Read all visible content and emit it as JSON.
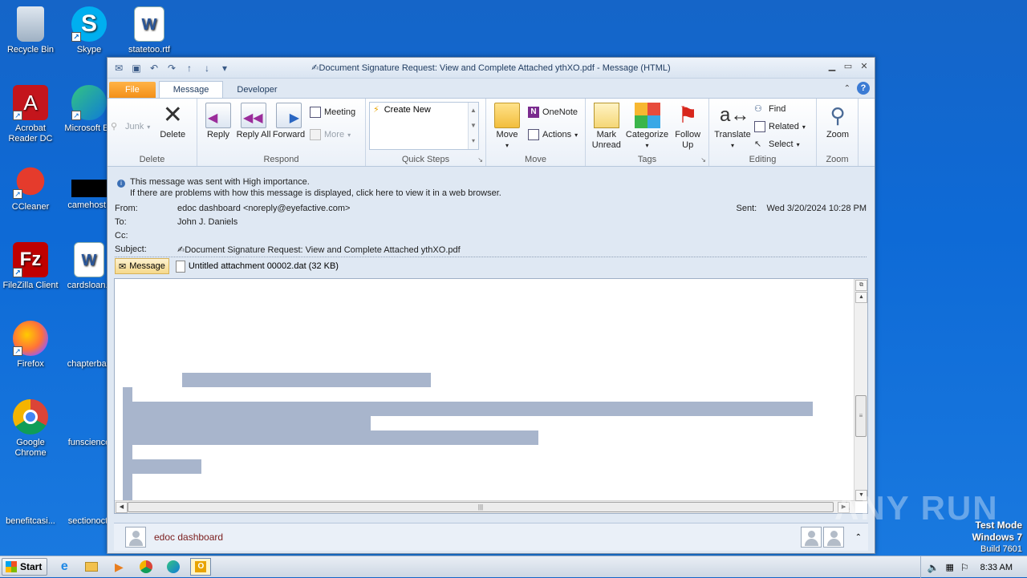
{
  "desktop": {
    "icons": [
      {
        "label": "Recycle Bin"
      },
      {
        "label": "Skype"
      },
      {
        "label": "statetoo.rtf"
      },
      {
        "label": "Acrobat Reader DC"
      },
      {
        "label": "Microsoft Ed"
      },
      {
        "label": "CCleaner"
      },
      {
        "label": "camehost.j"
      },
      {
        "label": "FileZilla Client"
      },
      {
        "label": "cardsloan.r"
      },
      {
        "label": "Firefox"
      },
      {
        "label": "chapterbay"
      },
      {
        "label": "Google Chrome"
      },
      {
        "label": "funscience"
      },
      {
        "label": "benefitcasi..."
      },
      {
        "label": "sectionoct."
      }
    ]
  },
  "window": {
    "title": "✍Document Signature Request: View and Complete Attached ythXO.pdf  -  Message (HTML)",
    "tabs": [
      {
        "label": "File"
      },
      {
        "label": "Message"
      },
      {
        "label": "Developer"
      }
    ]
  },
  "ribbon": {
    "delete_group": {
      "junk": "Junk",
      "delete": "Delete",
      "title": "Delete"
    },
    "respond_group": {
      "reply": "Reply",
      "reply_all": "Reply All",
      "forward": "Forward",
      "meeting": "Meeting",
      "more": "More",
      "title": "Respond"
    },
    "quicksteps_group": {
      "create_new": "Create New",
      "title": "Quick Steps"
    },
    "move_group": {
      "move": "Move",
      "onenote": "OneNote",
      "actions": "Actions",
      "title": "Move"
    },
    "tags_group": {
      "mark_unread": "Mark Unread",
      "categorize": "Categorize",
      "follow_up": "Follow Up",
      "title": "Tags"
    },
    "editing_group": {
      "translate": "Translate",
      "find": "Find",
      "related": "Related",
      "select": "Select",
      "title": "Editing"
    },
    "zoom_group": {
      "zoom": "Zoom",
      "title": "Zoom"
    }
  },
  "message": {
    "info_line1": "This message was sent with High importance.",
    "info_line2": "If there are problems with how this message is displayed, click here to view it in a web browser.",
    "from_label": "From:",
    "from_value": "edoc dashboard <noreply@eyefactive.com>",
    "to_label": "To:",
    "to_value": "John J. Daniels",
    "cc_label": "Cc:",
    "subject_label": "Subject:",
    "subject_value": "✍Document Signature Request: View and Complete Attached ythXO.pdf",
    "sent_label": "Sent:",
    "sent_value": "Wed 3/20/2024 10:28 PM",
    "attach_message_label": "Message",
    "attachment_name": "Untitled attachment 00002.dat (32 KB)"
  },
  "people_pane": {
    "name": "edoc dashboard"
  },
  "taskbar": {
    "start_label": "Start",
    "clock": "8:33 AM"
  },
  "watermark": {
    "line1": "Test Mode",
    "line2": "Windows 7",
    "line3": "Build 7601",
    "brand": "ANY RUN"
  },
  "colors": {
    "desktop": "#1565c8",
    "file_tab": "#f39019",
    "placeholder_bars": "#a8b5cc"
  }
}
